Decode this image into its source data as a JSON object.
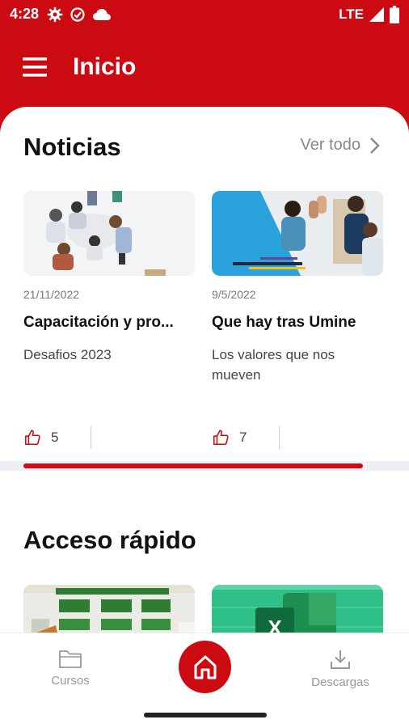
{
  "status_bar": {
    "time": "4:28",
    "network": "LTE",
    "icons": [
      "settings-icon",
      "check-circle-icon",
      "cloud-icon",
      "signal-icon",
      "battery-icon"
    ]
  },
  "app_bar": {
    "title": "Inicio",
    "menu_icon": "menu-icon"
  },
  "news": {
    "title": "Noticias",
    "see_all": "Ver todo",
    "items": [
      {
        "date": "21/11/2022",
        "title": "Capacitación y pro...",
        "subtitle": "Desafios 2023",
        "likes": "5"
      },
      {
        "date": "9/5/2022",
        "title": "Que hay tras Umine",
        "subtitle": "Los valores que nos mueven",
        "likes": "7"
      }
    ],
    "carousel_progress": 0.88
  },
  "quick_access": {
    "title": "Acceso rápido"
  },
  "bottom_nav": {
    "items": [
      {
        "label": "Cursos",
        "icon": "folder-icon"
      },
      {
        "label": "",
        "icon": "home-icon"
      },
      {
        "label": "Descargas",
        "icon": "download-icon"
      }
    ]
  },
  "colors": {
    "brand": "#cc0a12",
    "accent_bar": "#d10a16"
  }
}
